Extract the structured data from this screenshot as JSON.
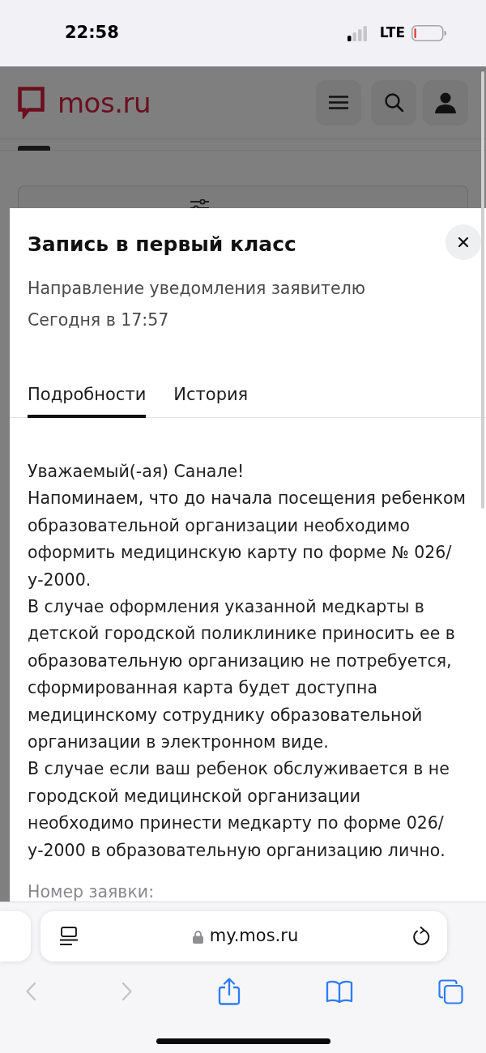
{
  "status_bar": {
    "time": "22:58",
    "network": "LTE"
  },
  "site_header": {
    "logo": "mos.ru"
  },
  "modal": {
    "title": "Запись в первый класс",
    "subtitle": "Направление уведомления заявителю",
    "date": "Сегодня в 17:57",
    "tabs": [
      {
        "label": "Подробности",
        "selected": true
      },
      {
        "label": "История",
        "selected": false
      }
    ],
    "message": [
      "Уважаемый(-ая) Санале!",
      "Напоминаем, что до начала посещения ребенком образовательной организации необходимо оформить медицинскую карту по форме № 026/у-2000.",
      "В случае оформления указанной медкарты в детской городской поликлинике приносить ее в образовательную организацию не потребуется, сформированная карта будет доступна медицинскому сотруднику образовательной организации в электронном виде.",
      "В случае если ваш ребенок обслуживается в не городской медицинской организации необходимо принести медкарту по форме 026/у-2000 в образовательную организацию лично."
    ],
    "request_number_label": "Номер заявки:"
  },
  "browser": {
    "url": "my.mos.ru",
    "toolbar": [
      {
        "kind": "back",
        "disabled": true
      },
      {
        "kind": "forward",
        "disabled": true
      },
      {
        "kind": "share",
        "disabled": false
      },
      {
        "kind": "bookmarks",
        "disabled": false
      },
      {
        "kind": "tabs",
        "disabled": false
      }
    ]
  }
}
